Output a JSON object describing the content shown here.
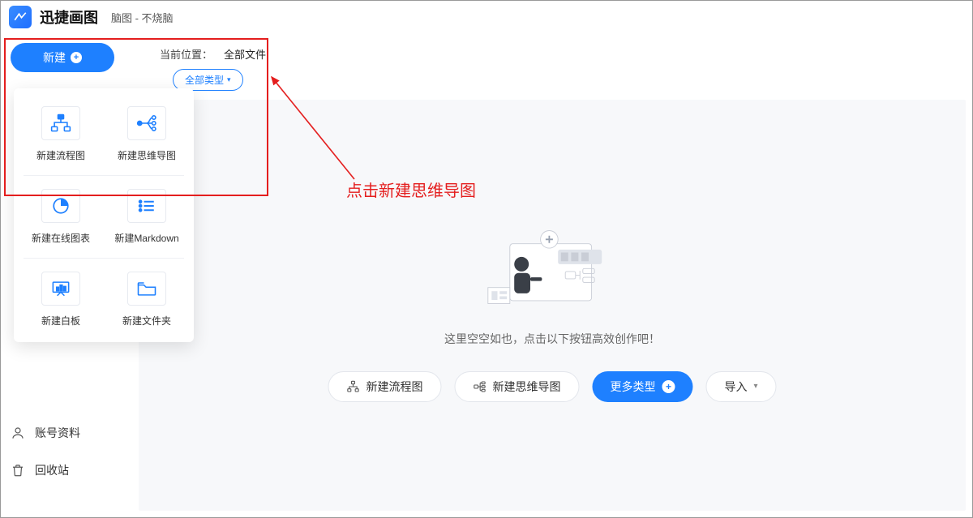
{
  "app": {
    "title": "迅捷画图",
    "subtitle": "脑图 - 不烧脑"
  },
  "newButton": {
    "label": "新建"
  },
  "breadcrumb": {
    "label": "当前位置：",
    "value": "全部文件"
  },
  "typeFilter": {
    "label": "全部类型"
  },
  "popover": {
    "items": [
      {
        "label": "新建流程图"
      },
      {
        "label": "新建思维导图"
      },
      {
        "label": "新建在线图表"
      },
      {
        "label": "新建Markdown"
      },
      {
        "label": "新建白板"
      },
      {
        "label": "新建文件夹"
      }
    ]
  },
  "annotation": {
    "text": "点击新建思维导图"
  },
  "empty": {
    "text": "这里空空如也，点击以下按钮高效创作吧！"
  },
  "cta": {
    "flowchart": "新建流程图",
    "mindmap": "新建思维导图",
    "more": "更多类型",
    "import": "导入"
  },
  "sidebar_bottom": {
    "account": "账号资料",
    "trash": "回收站"
  },
  "colors": {
    "accent": "#1e80ff",
    "danger": "#e41e1e"
  }
}
